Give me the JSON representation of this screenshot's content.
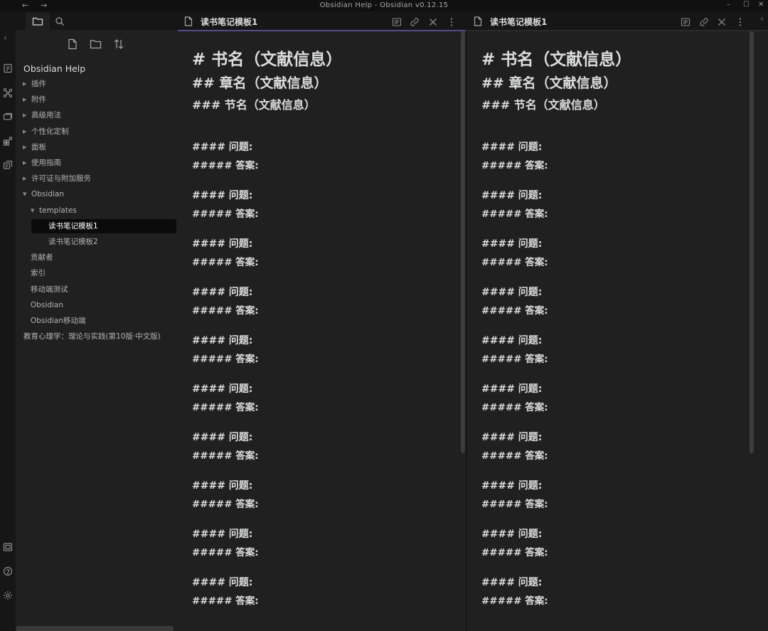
{
  "window": {
    "title": "Obsidian Help - Obsidian v0.12.15",
    "back": "←",
    "forward": "→",
    "minimize": "–",
    "maximize": "☐",
    "close": "✕"
  },
  "sidebar": {
    "vault_name": "Obsidian Help",
    "collapse_glyph": "‹",
    "tree": [
      {
        "label": "插件",
        "arrow": "▶",
        "depth": 0
      },
      {
        "label": "附件",
        "arrow": "▶",
        "depth": 0
      },
      {
        "label": "高级用法",
        "arrow": "▶",
        "depth": 0
      },
      {
        "label": "个性化定制",
        "arrow": "▶",
        "depth": 0
      },
      {
        "label": "面板",
        "arrow": "▶",
        "depth": 0
      },
      {
        "label": "使用指南",
        "arrow": "▶",
        "depth": 0
      },
      {
        "label": "许可证与附加服务",
        "arrow": "▶",
        "depth": 0
      },
      {
        "label": "Obsidian",
        "arrow": "▼",
        "depth": 0
      },
      {
        "label": "templates",
        "arrow": "▼",
        "depth": 1
      },
      {
        "label": "读书笔记模板1",
        "arrow": "",
        "depth": 2,
        "active": true
      },
      {
        "label": "读书笔记模板2",
        "arrow": "",
        "depth": 2
      },
      {
        "label": "贡献者",
        "arrow": "",
        "depth": 1
      },
      {
        "label": "索引",
        "arrow": "",
        "depth": 1
      },
      {
        "label": "移动端测试",
        "arrow": "",
        "depth": 1
      },
      {
        "label": "Obsidian",
        "arrow": "",
        "depth": 1
      },
      {
        "label": "Obsidian移动端",
        "arrow": "",
        "depth": 1
      },
      {
        "label": "教育心理学：理论与实践(第10版·中文版)",
        "arrow": "",
        "depth": 0
      }
    ]
  },
  "panes": {
    "left": {
      "title": "读书笔记模板1"
    },
    "right": {
      "title": "读书笔记模板1",
      "collapse_glyph": "‹"
    }
  },
  "note": {
    "h1": "# 书名（文献信息）",
    "h2": "## 章名（文献信息）",
    "h3": "### 节名（文献信息）",
    "question": "#### 问题:",
    "answer": "##### 答案:",
    "qa_repeat": 10
  },
  "colors": {
    "accent": "#5a4a8a",
    "background": "#202020",
    "chrome": "#161616",
    "text": "#dcddde"
  }
}
